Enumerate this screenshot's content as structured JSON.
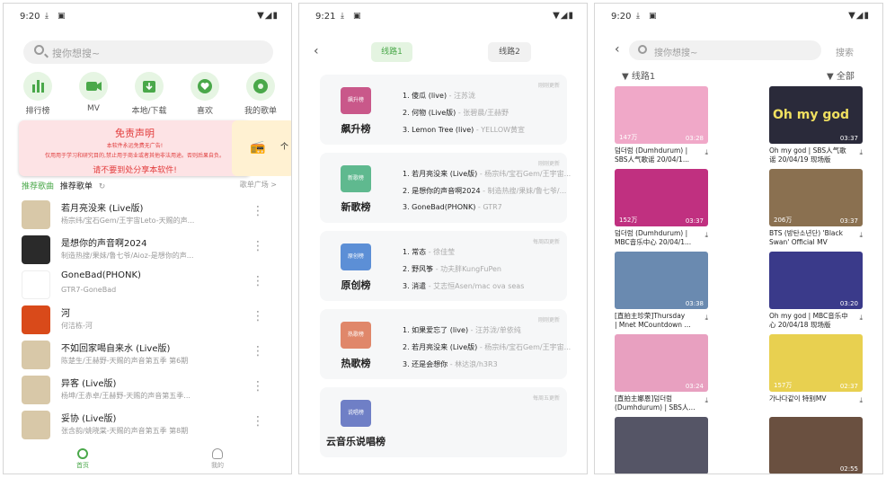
{
  "status_bar": {
    "panel1_time": "9:20",
    "panel2_time": "9:21",
    "panel3_time": "9:20"
  },
  "panel1": {
    "search_placeholder": "搜你想搜~",
    "categories": [
      {
        "label": "排行榜",
        "icon": "bar-chart-icon"
      },
      {
        "label": "MV",
        "icon": "video-icon"
      },
      {
        "label": "本地/下载",
        "icon": "download-icon"
      },
      {
        "label": "喜欢",
        "icon": "heart-icon"
      },
      {
        "label": "我的歌单",
        "icon": "disc-icon"
      }
    ],
    "banner": {
      "title": "免责声明",
      "line1": "本软件永远免费无广告!",
      "line2": "仅用用于学习和研究目的,禁止用于商业或者其他非法用途。否则后果自负。",
      "warning": "请不要到处分享本软件!"
    },
    "banner2_partial": "个",
    "tab_recommend_songs": "推荐歌曲",
    "tab_recommend_playlist": "推荐歌单",
    "playlist_square": "歌单广场 >",
    "songs": [
      {
        "title": "若月亮没来 (Live版)",
        "sub": "杨宗纬/宝石Gem/王宇宙Leto-天赐的声...",
        "color": "#d8c8a8"
      },
      {
        "title": "是想你的声音啊2024",
        "sub": "制造热搜/果妹/鲁七爷/Aioz-是想你的声...",
        "color": "#2a2a2a"
      },
      {
        "title": "GoneBad(PHONK)",
        "sub": "GTR7-GoneBad",
        "color": "#ffffff"
      },
      {
        "title": "河",
        "sub": "何洁栋-河",
        "color": "#d94a1a"
      },
      {
        "title": "不如回家喝自来水 (Live版)",
        "sub": "陈楚生/王赫野-天赐的声音第五季 第6期",
        "color": "#d8c8a8"
      },
      {
        "title": "异客 (Live版)",
        "sub": "杨坤/王赤卓/王赫野-天赐的声音第五季...",
        "color": "#d8c8a8"
      },
      {
        "title": "妥协 (Live版)",
        "sub": "张含韵/姚晓棠-天赐的声音第五季 第8期",
        "color": "#d8c8a8"
      }
    ],
    "nav": {
      "home": "首页",
      "mine": "我的"
    }
  },
  "panel2": {
    "route1": "线路1",
    "route2": "线路2",
    "ranks": [
      {
        "cover": "飙升榜",
        "name": "飙升榜",
        "update": "刚刚更新",
        "color": "#c9588a",
        "lines": [
          {
            "n": "1. 傻瓜 (live)",
            "a": " - 汪苏泷"
          },
          {
            "n": "2. 何物 (Live版)",
            "a": " - 张碧晨/王赫野"
          },
          {
            "n": "3. Lemon Tree (live)",
            "a": " - YELLOW黄宣"
          }
        ]
      },
      {
        "cover": "新歌榜",
        "name": "新歌榜",
        "update": "刚刚更新",
        "color": "#5fb98f",
        "lines": [
          {
            "n": "1. 若月亮没来 (Live版)",
            "a": " - 杨宗纬/宝石Gem/王宇宙..."
          },
          {
            "n": "2. 是想你的声音啊2024",
            "a": " - 制造热搜/果妹/鲁七爷/..."
          },
          {
            "n": "3. GoneBad(PHONK)",
            "a": " - GTR7"
          }
        ]
      },
      {
        "cover": "原创榜",
        "name": "原创榜",
        "update": "每周四更新",
        "color": "#5c8fd6",
        "lines": [
          {
            "n": "1. 常态",
            "a": " - 徐佳莹"
          },
          {
            "n": "2. 野风筝",
            "a": " - 功夫胖KungFuPen"
          },
          {
            "n": "3. 消遣",
            "a": " - 艾志恒Asen/mac ova seas"
          }
        ]
      },
      {
        "cover": "热歌榜",
        "name": "热歌榜",
        "update": "刚刚更新",
        "color": "#e0876a",
        "lines": [
          {
            "n": "1. 如果爱忘了 (live)",
            "a": " - 汪苏泷/单依纯"
          },
          {
            "n": "2. 若月亮没来 (Live版)",
            "a": " - 杨宗纬/宝石Gem/王宇宙..."
          },
          {
            "n": "3. 还是会想你",
            "a": " - 林达浪/h3R3"
          }
        ]
      },
      {
        "cover": "说唱榜",
        "name": "云音乐说唱榜",
        "update": "每周五更新",
        "color": "#6f7fc6",
        "lines": []
      }
    ]
  },
  "panel3": {
    "search_placeholder": "搜你想搜~",
    "search_button": "搜索",
    "route": "线路1",
    "filter": "全部",
    "videos": [
      {
        "views": "147万",
        "dur": "03:28",
        "cap": "덤더럼 (Dumhdurum) |\nSBS人气歌谣 20/04/1...",
        "color": "#f0a8c8"
      },
      {
        "views": "",
        "dur": "03:37",
        "cap": "Oh my god | SBS人气歌\n谣 20/04/19 现场版",
        "color": "#2a2a3a",
        "overlay": "Oh my god"
      },
      {
        "views": "152万",
        "dur": "03:37",
        "cap": "덤더럼 (Dumhdurum) |\nMBC音乐中心 20/04/1...",
        "color": "#c03080"
      },
      {
        "views": "206万",
        "dur": "03:37",
        "cap": "BTS (방탄소년단) 'Black\nSwan' Official MV",
        "color": "#8a7050"
      },
      {
        "views": "",
        "dur": "03:38",
        "cap": "[直拍主珍荣]Thursday\n| Mnet MCountdown ...",
        "color": "#6a8ab0"
      },
      {
        "views": "",
        "dur": "03:20",
        "cap": "Oh my god | MBC音乐中\n心 20/04/18 现场版",
        "color": "#3a3a8a"
      },
      {
        "views": "",
        "dur": "03:24",
        "cap": "[直拍主娜恩]덤더럼\n(Dumhdurum) | SBS人...",
        "color": "#e8a0c0"
      },
      {
        "views": "157万",
        "dur": "02:37",
        "cap": "가나다같이 特别MV",
        "color": "#e8d050"
      },
      {
        "views": "",
        "dur": "",
        "cap": "",
        "color": "#555566"
      },
      {
        "views": "",
        "dur": "02:55",
        "cap": "",
        "color": "#6a5040"
      }
    ]
  }
}
